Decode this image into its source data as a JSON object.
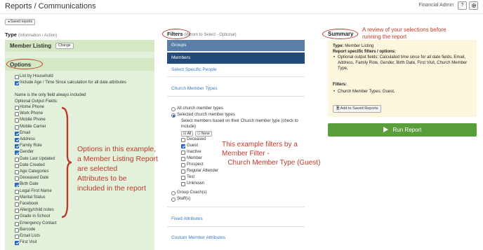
{
  "header": {
    "title": "Reports / Communications",
    "user": "Financial Admin",
    "help_icon": "?",
    "settings_icon": "gear-icon"
  },
  "saved_reports_button": "◂ Saved reports",
  "type_section": {
    "label": "Type",
    "sublabel": "(Information / Action)",
    "report_name": "Member Listing",
    "change_button": "Change"
  },
  "options": {
    "title": "Options",
    "checkboxes": [
      {
        "label": "List by Household",
        "checked": false
      },
      {
        "label": "Include Age / Time Since calculation for all date attributes",
        "checked": true
      }
    ],
    "note": "Name is the only field always included",
    "fields_label": "Optional Output Fields:",
    "fields": [
      {
        "label": "Home Phone",
        "checked": false
      },
      {
        "label": "Work Phone",
        "checked": false
      },
      {
        "label": "Mobile Phone",
        "checked": false
      },
      {
        "label": "Mobile Carrier",
        "checked": false
      },
      {
        "label": "Email",
        "checked": true
      },
      {
        "label": "Address",
        "checked": true
      },
      {
        "label": "Family Role",
        "checked": true
      },
      {
        "label": "Gender",
        "checked": true
      },
      {
        "label": "Date Last Updated",
        "checked": false
      },
      {
        "label": "Date Created",
        "checked": false
      },
      {
        "label": "Age Categories",
        "checked": false
      },
      {
        "label": "Deceased Date",
        "checked": false
      },
      {
        "label": "Birth Date",
        "checked": true
      },
      {
        "label": "Legal First Name",
        "checked": false
      },
      {
        "label": "Marital Status",
        "checked": false
      },
      {
        "label": "Facebook",
        "checked": false
      },
      {
        "label": "Allergy/child notes",
        "checked": false
      },
      {
        "label": "Grade in School",
        "checked": false
      },
      {
        "label": "Emergency Contact",
        "checked": false
      },
      {
        "label": "Barcode",
        "checked": false
      },
      {
        "label": "Email Lists",
        "checked": false
      },
      {
        "label": "First Visit",
        "checked": true
      }
    ]
  },
  "annotations": {
    "options": [
      "Options in this example,",
      "a Member Listing Report",
      "are selected",
      "Attributes to be",
      "included in the report"
    ],
    "filters": [
      "This example filters by a",
      "Member Filter -",
      "   Church Member Type (Guest)"
    ],
    "summary": [
      "A review of your selections before",
      "running the report"
    ]
  },
  "filters": {
    "label": "Filters",
    "sublabel": "(Whom to Select - Optional)",
    "groups_tab": "Groups",
    "members_tab": "Members",
    "select_specific_people": "Select Specific People",
    "church_member_types": "Church Member Types",
    "radio_all": "All church member types",
    "radio_selected": "Selected church member types",
    "selected_help": "Select members based on their Church member type (check to include)",
    "all_button": "☑ All",
    "none_button": "☐ None",
    "types": [
      {
        "label": "Deceased",
        "checked": false
      },
      {
        "label": "Guest",
        "checked": true
      },
      {
        "label": "Inactive",
        "checked": false
      },
      {
        "label": "Member",
        "checked": false
      },
      {
        "label": "Prospect",
        "checked": false
      },
      {
        "label": "Regular Attender",
        "checked": false
      },
      {
        "label": "Test",
        "checked": false
      },
      {
        "label": "Unknown",
        "checked": false
      }
    ],
    "radio_group_coach": "Group Coach(s)",
    "radio_staff": "Staff(s)",
    "fixed_attributes": "Fixed Attributes",
    "custom_member_attributes": "Custom Member Attributes"
  },
  "summary": {
    "label": "Summary",
    "type_line_label": "Type:",
    "type_line_value": "Member Listing",
    "filters_options_label": "Report specific filters / options:",
    "option_bullet": "Optional output fields: Calculated time since for all date fields, Email, Address, Family Role, Gender, Birth Date, First Visit, Church Member Type,",
    "filters_label": "Filters:",
    "filter_bullet": "Church Member Types: Guest,",
    "add_saved_button": "Add to Saved Reports",
    "run_button": "Run Report"
  },
  "colors": {
    "accent_red": "#c0392b",
    "run_green": "#5a9e3c",
    "members_bar": "#234a78",
    "groups_bar": "#5a7fa8",
    "options_bg": "#e3f0da",
    "summary_bg": "#fcf6dc",
    "link_blue": "#3b79c8"
  }
}
